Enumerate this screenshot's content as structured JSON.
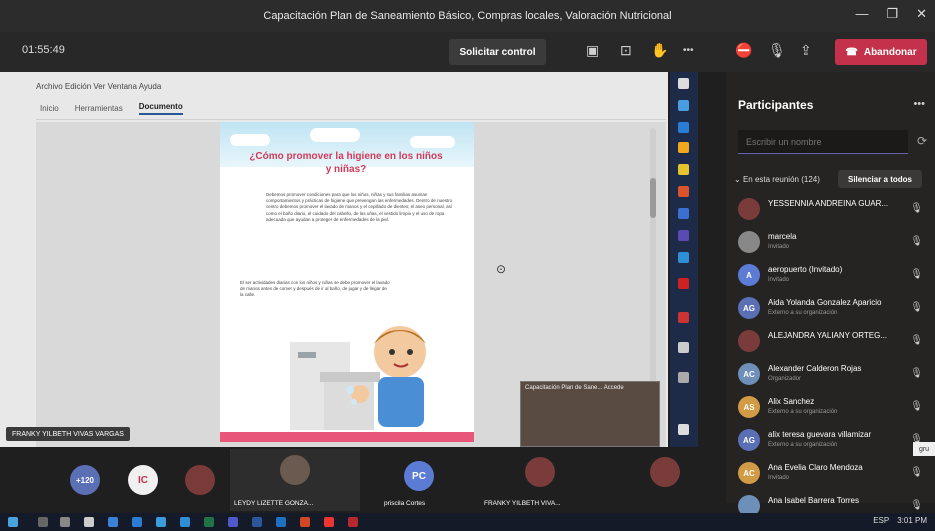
{
  "window": {
    "title": "Capacitación Plan de Saneamiento Básico, Compras locales, Valoración Nutricional",
    "minimize": "—",
    "maximize": "❐",
    "close": "✕"
  },
  "toolbar": {
    "timer": "01:55:49",
    "request_control_label": "Solicitar control",
    "more_label": "•••",
    "leave_label": "Abandonar"
  },
  "shared_app": {
    "menu": "Archivo  Edición  Ver  Ventana  Ayuda",
    "tabs": [
      "Inicio",
      "Herramientas",
      "Documento"
    ],
    "active_tab": "Documento",
    "page_title": "¿Cómo promover la higiene en los niños y niñas?",
    "paragraph1": "Debemos promover condiciones para que los niños, niñas y sus familias asuman comportamientos y prácticas de higiene que prevengan las enfermedades. Dentro de nuestro centro debemos promover el lavado de manos y el cepillado de dientes; el aseo personal, así como el baño diario, el cuidado del cabello, de las uñas, el vestido limpio y el uso de ropa adecuada que ayudan a proteger de enfermedades de la piel.",
    "paragraph2": "El ser actividades diarias con los niños y niñas se debe promover el lavado de manos antes de comer y después de ir al baño, de jugar y de llegar de la calle.",
    "sharer_label": "FRANKY YILBETH VIVAS VARGAS"
  },
  "mini_video": {
    "label": "Capacitación Plan de Sane... Accede"
  },
  "participants": {
    "title": "Participantes",
    "more": "•••",
    "search_placeholder": "Escribir un nombre",
    "section_label": "En esta reunión (124)",
    "mute_all_label": "Silenciar a todos",
    "list": [
      {
        "name": "YESSENNIA ANDREINA GUAR...",
        "sub": "",
        "initials": "",
        "color": "#7a3b3b"
      },
      {
        "name": "marcela",
        "sub": "Invitado",
        "initials": "",
        "color": "#888888"
      },
      {
        "name": "aeropuerto (Invitado)",
        "sub": "Invitado",
        "initials": "A",
        "color": "#5b7bd5"
      },
      {
        "name": "Aida Yolanda Gonzalez Aparicio",
        "sub": "Externo a su organización",
        "initials": "AG",
        "color": "#5b6fb5"
      },
      {
        "name": "ALEJANDRA YALIANY ORTEG...",
        "sub": "",
        "initials": "",
        "color": "#7a3b3b"
      },
      {
        "name": "Alexander Calderon Rojas",
        "sub": "Organizador",
        "initials": "AC",
        "color": "#6d8fb8"
      },
      {
        "name": "Alix Sanchez",
        "sub": "Externo a su organización",
        "initials": "AS",
        "color": "#d19a45"
      },
      {
        "name": "alix teresa guevara villamizar",
        "sub": "Externo a su organización",
        "initials": "AG",
        "color": "#5b6fb5"
      },
      {
        "name": "Ana Evelia Claro Mendoza",
        "sub": "Invitado",
        "initials": "AC",
        "color": "#d19a45"
      },
      {
        "name": "Ana Isabel Barrera Torres",
        "sub": "",
        "initials": "",
        "color": "#6d8fb8"
      }
    ]
  },
  "tooltip": "gru",
  "gallery": {
    "overflow_count": "+120",
    "tiles": [
      {
        "initials": "IC",
        "color": "#f0f0f0",
        "text_color": "#c4314b",
        "label": ""
      },
      {
        "initials": "",
        "color": "#7a3b3b",
        "text_color": "#fff",
        "label": ""
      },
      {
        "initials": "",
        "color": "#6a5a50",
        "text_color": "#fff",
        "label": "LEYDY LIZETTE GONZA..."
      },
      {
        "initials": "PC",
        "color": "#5b7bd5",
        "text_color": "#fff",
        "label": "priscila Cortes"
      },
      {
        "initials": "",
        "color": "#7a3b3b",
        "text_color": "#fff",
        "label": "FRANKY YILBETH VIVA..."
      },
      {
        "initials": "",
        "color": "#7a3b3b",
        "text_color": "#fff",
        "label": ""
      }
    ]
  },
  "taskbar": {
    "language": "ESP",
    "time": "3:01 PM"
  }
}
